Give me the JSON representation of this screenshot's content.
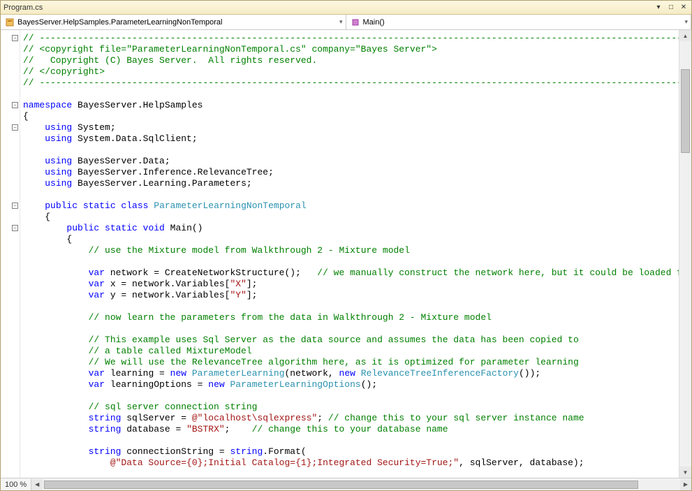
{
  "window": {
    "title": "Program.cs"
  },
  "dropdowns": {
    "left": "BayesServer.HelpSamples.ParameterLearningNonTemporal",
    "right": "Main()"
  },
  "zoom": "100 %",
  "code": {
    "lines": [
      [
        [
          "cm",
          "// -----------------------------------------------------------------------------------------------------------------------------------------"
        ]
      ],
      [
        [
          "cm",
          "// <copyright file=\"ParameterLearningNonTemporal.cs\" company=\"Bayes Server\">"
        ]
      ],
      [
        [
          "cm",
          "//   Copyright (C) Bayes Server.  All rights reserved."
        ]
      ],
      [
        [
          "cm",
          "// </copyright>"
        ]
      ],
      [
        [
          "cm",
          "// -----------------------------------------------------------------------------------------------------------------------------------------"
        ]
      ],
      [],
      [
        [
          "kw",
          "namespace"
        ],
        [
          "txt",
          " BayesServer.HelpSamples"
        ]
      ],
      [
        [
          "txt",
          "{"
        ]
      ],
      [
        [
          "txt",
          "    "
        ],
        [
          "kw",
          "using"
        ],
        [
          "txt",
          " System;"
        ]
      ],
      [
        [
          "txt",
          "    "
        ],
        [
          "kw",
          "using"
        ],
        [
          "txt",
          " System.Data.SqlClient;"
        ]
      ],
      [],
      [
        [
          "txt",
          "    "
        ],
        [
          "kw",
          "using"
        ],
        [
          "txt",
          " BayesServer.Data;"
        ]
      ],
      [
        [
          "txt",
          "    "
        ],
        [
          "kw",
          "using"
        ],
        [
          "txt",
          " BayesServer.Inference.RelevanceTree;"
        ]
      ],
      [
        [
          "txt",
          "    "
        ],
        [
          "kw",
          "using"
        ],
        [
          "txt",
          " BayesServer.Learning.Parameters;"
        ]
      ],
      [],
      [
        [
          "txt",
          "    "
        ],
        [
          "kw",
          "public static class"
        ],
        [
          "txt",
          " "
        ],
        [
          "type",
          "ParameterLearningNonTemporal"
        ]
      ],
      [
        [
          "txt",
          "    {"
        ]
      ],
      [
        [
          "txt",
          "        "
        ],
        [
          "kw",
          "public static void"
        ],
        [
          "txt",
          " Main()"
        ]
      ],
      [
        [
          "txt",
          "        {"
        ]
      ],
      [
        [
          "txt",
          "            "
        ],
        [
          "cm",
          "// use the Mixture model from Walkthrough 2 - Mixture model"
        ]
      ],
      [],
      [
        [
          "txt",
          "            "
        ],
        [
          "kw",
          "var"
        ],
        [
          "txt",
          " network = CreateNetworkStructure();   "
        ],
        [
          "cm",
          "// we manually construct the network here, but it could be loaded from a file"
        ]
      ],
      [
        [
          "txt",
          "            "
        ],
        [
          "kw",
          "var"
        ],
        [
          "txt",
          " x = network.Variables["
        ],
        [
          "str",
          "\"X\""
        ],
        [
          "txt",
          "];"
        ]
      ],
      [
        [
          "txt",
          "            "
        ],
        [
          "kw",
          "var"
        ],
        [
          "txt",
          " y = network.Variables["
        ],
        [
          "str",
          "\"Y\""
        ],
        [
          "txt",
          "];"
        ]
      ],
      [],
      [
        [
          "txt",
          "            "
        ],
        [
          "cm",
          "// now learn the parameters from the data in Walkthrough 2 - Mixture model"
        ]
      ],
      [],
      [
        [
          "txt",
          "            "
        ],
        [
          "cm",
          "// This example uses Sql Server as the data source and assumes the data has been copied to"
        ]
      ],
      [
        [
          "txt",
          "            "
        ],
        [
          "cm",
          "// a table called MixtureModel"
        ]
      ],
      [
        [
          "txt",
          "            "
        ],
        [
          "cm",
          "// We will use the RelevanceTree algorithm here, as it is optimized for parameter learning"
        ]
      ],
      [
        [
          "txt",
          "            "
        ],
        [
          "kw",
          "var"
        ],
        [
          "txt",
          " learning = "
        ],
        [
          "kw",
          "new"
        ],
        [
          "txt",
          " "
        ],
        [
          "type",
          "ParameterLearning"
        ],
        [
          "txt",
          "(network, "
        ],
        [
          "kw",
          "new"
        ],
        [
          "txt",
          " "
        ],
        [
          "type",
          "RelevanceTreeInferenceFactory"
        ],
        [
          "txt",
          "());"
        ]
      ],
      [
        [
          "txt",
          "            "
        ],
        [
          "kw",
          "var"
        ],
        [
          "txt",
          " learningOptions = "
        ],
        [
          "kw",
          "new"
        ],
        [
          "txt",
          " "
        ],
        [
          "type",
          "ParameterLearningOptions"
        ],
        [
          "txt",
          "();"
        ]
      ],
      [],
      [
        [
          "txt",
          "            "
        ],
        [
          "cm",
          "// sql server connection string"
        ]
      ],
      [
        [
          "txt",
          "            "
        ],
        [
          "kw",
          "string"
        ],
        [
          "txt",
          " sqlServer = "
        ],
        [
          "str",
          "@\"localhost\\sqlexpress\""
        ],
        [
          "txt",
          "; "
        ],
        [
          "cm",
          "// change this to your sql server instance name"
        ]
      ],
      [
        [
          "txt",
          "            "
        ],
        [
          "kw",
          "string"
        ],
        [
          "txt",
          " database = "
        ],
        [
          "str",
          "\"BSTRX\""
        ],
        [
          "txt",
          ";    "
        ],
        [
          "cm",
          "// change this to your database name"
        ]
      ],
      [],
      [
        [
          "txt",
          "            "
        ],
        [
          "kw",
          "string"
        ],
        [
          "txt",
          " connectionString = "
        ],
        [
          "kw",
          "string"
        ],
        [
          "txt",
          ".Format("
        ]
      ],
      [
        [
          "txt",
          "                "
        ],
        [
          "str",
          "@\"Data Source={0};Initial Catalog={1};Integrated Security=True;\""
        ],
        [
          "txt",
          ", sqlServer, database);"
        ]
      ]
    ],
    "folds": [
      0,
      6,
      8,
      15,
      17
    ]
  }
}
